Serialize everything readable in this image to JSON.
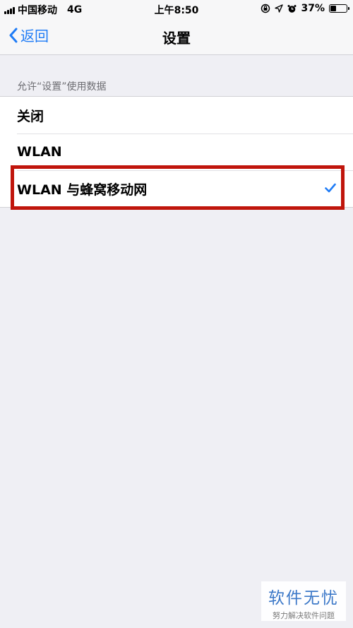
{
  "status_bar": {
    "carrier": "中国移动",
    "network": "4G",
    "time": "上午8:50",
    "battery_text": "37%",
    "battery_level": 0.37
  },
  "nav": {
    "back_label": "返回",
    "title": "设置"
  },
  "section": {
    "header": "允许“设置”使用数据"
  },
  "options": [
    {
      "label": "关闭",
      "selected": false
    },
    {
      "label": "WLAN",
      "selected": false
    },
    {
      "label": "WLAN 与蜂窝移动网",
      "selected": true
    }
  ],
  "watermark": {
    "title": "软件无忧",
    "subtitle": "努力解决软件问题"
  },
  "colors": {
    "accent": "#1f7cf6",
    "highlight": "#c0150c",
    "background": "#efeff4"
  }
}
